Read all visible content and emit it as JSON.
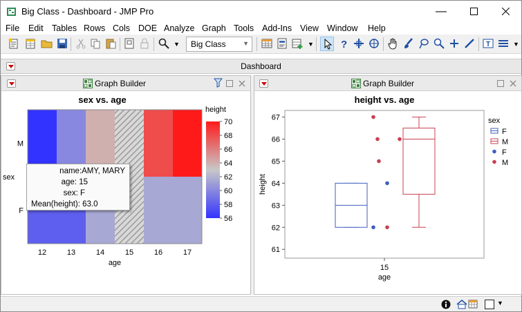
{
  "window": {
    "title": "Big Class - Dashboard - JMP Pro"
  },
  "menu": [
    "File",
    "Edit",
    "Tables",
    "Rows",
    "Cols",
    "DOE",
    "Analyze",
    "Graph",
    "Tools",
    "Add-Ins",
    "View",
    "Window",
    "Help"
  ],
  "toolbar": {
    "table_combo": "Big Class"
  },
  "dashboard": {
    "title": "Dashboard"
  },
  "left_panel": {
    "header": "Graph Builder"
  },
  "right_panel": {
    "header": "Graph Builder"
  },
  "tooltip": {
    "name_label": "name:",
    "name_value": "AMY, MARY",
    "age_label": "age:",
    "age_value": "15",
    "sex_label": "sex:",
    "sex_value": "F",
    "mean_label": "Mean(height):",
    "mean_value": "63.0"
  },
  "colors": {
    "high": "#ff1a1a",
    "mid": "#c8c8c8",
    "low": "#3333ff",
    "female": "#3e5fbd",
    "male": "#c84050"
  },
  "chart_data": [
    {
      "type": "heatmap",
      "title": "sex vs. age",
      "xlabel": "age",
      "ylabel": "sex",
      "x_categories": [
        "12",
        "13",
        "14",
        "15",
        "16",
        "17"
      ],
      "y_categories": [
        "M",
        "F"
      ],
      "values": {
        "M": [
          56.0,
          60.0,
          64.0,
          null,
          68.0,
          70.0
        ],
        "F": [
          58.0,
          58.0,
          61.5,
          null,
          61.5,
          61.5
        ]
      },
      "hatched_cells": [
        {
          "sex": "M",
          "age": "15"
        },
        {
          "sex": "F",
          "age": "15"
        }
      ],
      "color_scale": {
        "title": "height",
        "min": 56,
        "max": 70,
        "ticks": [
          56,
          58,
          60,
          62,
          64,
          66,
          68,
          70
        ]
      }
    },
    {
      "type": "box",
      "title": "height vs. age",
      "xlabel": "age",
      "ylabel": "height",
      "x_categories": [
        "15"
      ],
      "ylim": [
        60.6,
        67.3
      ],
      "yticks": [
        61,
        62,
        63,
        64,
        65,
        66,
        67
      ],
      "legend_title": "sex",
      "legend": [
        {
          "label": "F",
          "kind": "box",
          "color": "#3e5fbd"
        },
        {
          "label": "M",
          "kind": "box",
          "color": "#c84050"
        },
        {
          "label": "F",
          "kind": "point",
          "color": "#3e5fbd"
        },
        {
          "label": "M",
          "kind": "point",
          "color": "#c84050"
        }
      ],
      "boxes": [
        {
          "name": "F",
          "q1": 62.0,
          "median": 63.0,
          "q3": 64.0,
          "min": 62.0,
          "max": 64.0
        },
        {
          "name": "M",
          "q1": 63.5,
          "median": 66.0,
          "q3": 66.5,
          "min": 62.0,
          "max": 67.0
        }
      ],
      "points": [
        {
          "sex": "F",
          "values": [
            62,
            64
          ]
        },
        {
          "sex": "M",
          "values": [
            67,
            66,
            65,
            62,
            66
          ]
        }
      ]
    }
  ]
}
